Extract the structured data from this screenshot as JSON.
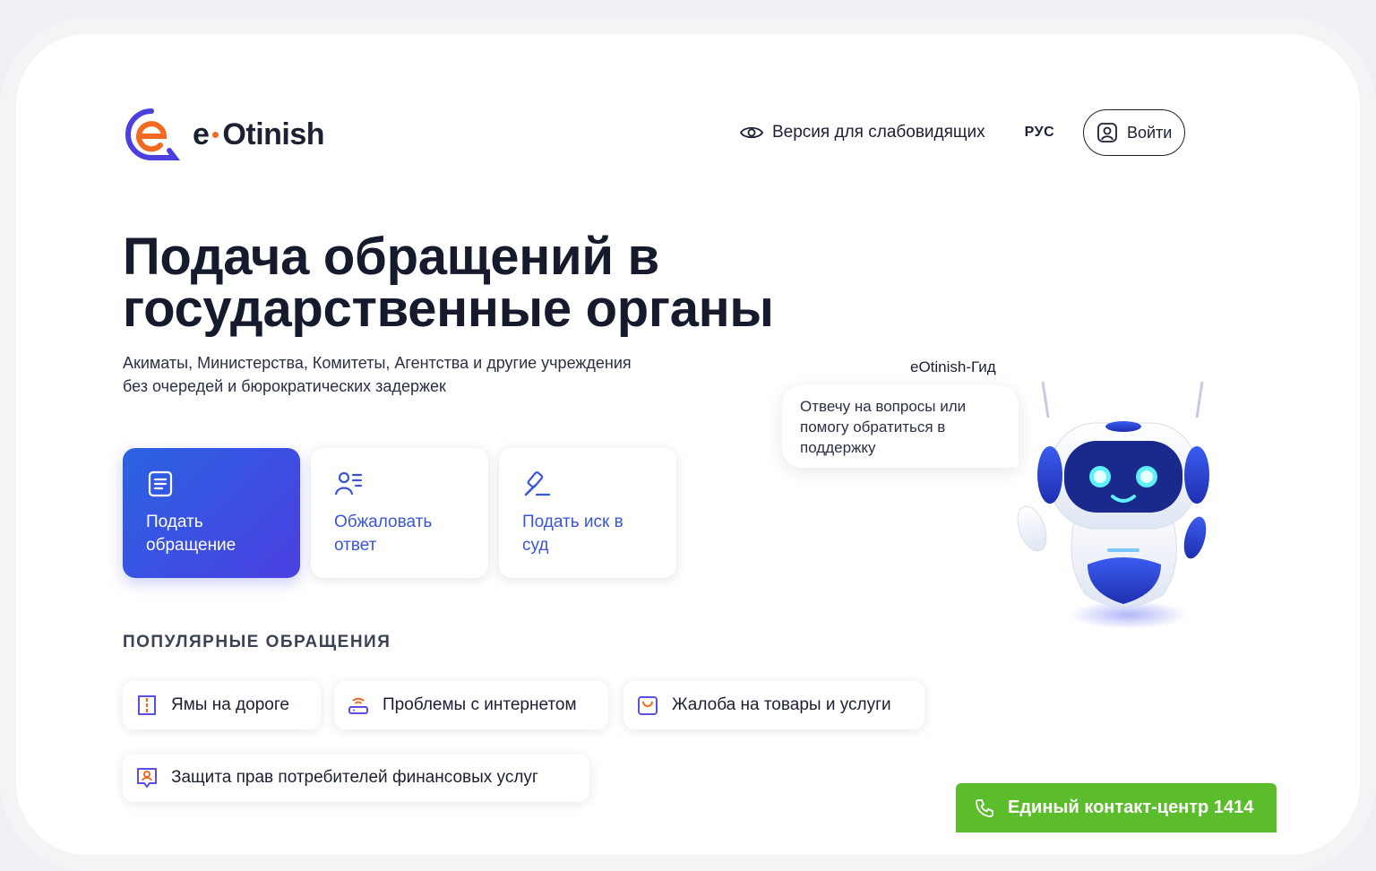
{
  "header": {
    "logo_text_e": "e",
    "logo_text_name": "Otinish",
    "visually_impaired_label": "Версия для слабовидящих",
    "language": "РУС",
    "login_label": "Войти"
  },
  "hero": {
    "title_line1": "Подача обращений в",
    "title_line2": "государственные органы",
    "subtitle_line1": "Акиматы, Министерства, Комитеты, Агентства и другие учреждения",
    "subtitle_line2": "без очередей и бюрократических задержек"
  },
  "actions": [
    {
      "line1": "Подать",
      "line2": "обращение",
      "icon": "document-icon"
    },
    {
      "line1": "Обжаловать",
      "line2": "ответ",
      "icon": "user-list-icon"
    },
    {
      "line1": "Подать иск в",
      "line2": "суд",
      "icon": "gavel-icon"
    }
  ],
  "popular": {
    "title": "ПОПУЛЯРНЫЕ ОБРАЩЕНИЯ",
    "items": [
      {
        "label": "Ямы на дороге",
        "icon": "road-icon"
      },
      {
        "label": "Проблемы с интернетом",
        "icon": "router-icon"
      },
      {
        "label": "Жалоба на товары и услуги",
        "icon": "shopping-bag-icon"
      },
      {
        "label": "Защита прав потребителей финансовых услуг",
        "icon": "consumer-rights-icon"
      }
    ]
  },
  "bot": {
    "name": "eOtinish-Гид",
    "bubble_line1": "Отвечу на вопросы или",
    "bubble_line2": "помогу обратиться в",
    "bubble_line3": "поддержку"
  },
  "contact": {
    "label": "Единый контакт-центр 1414"
  },
  "colors": {
    "brand_blue": "#3a56d8",
    "brand_orange": "#f26a21",
    "contact_green": "#5bbd2b",
    "text_dark": "#151a2d"
  }
}
